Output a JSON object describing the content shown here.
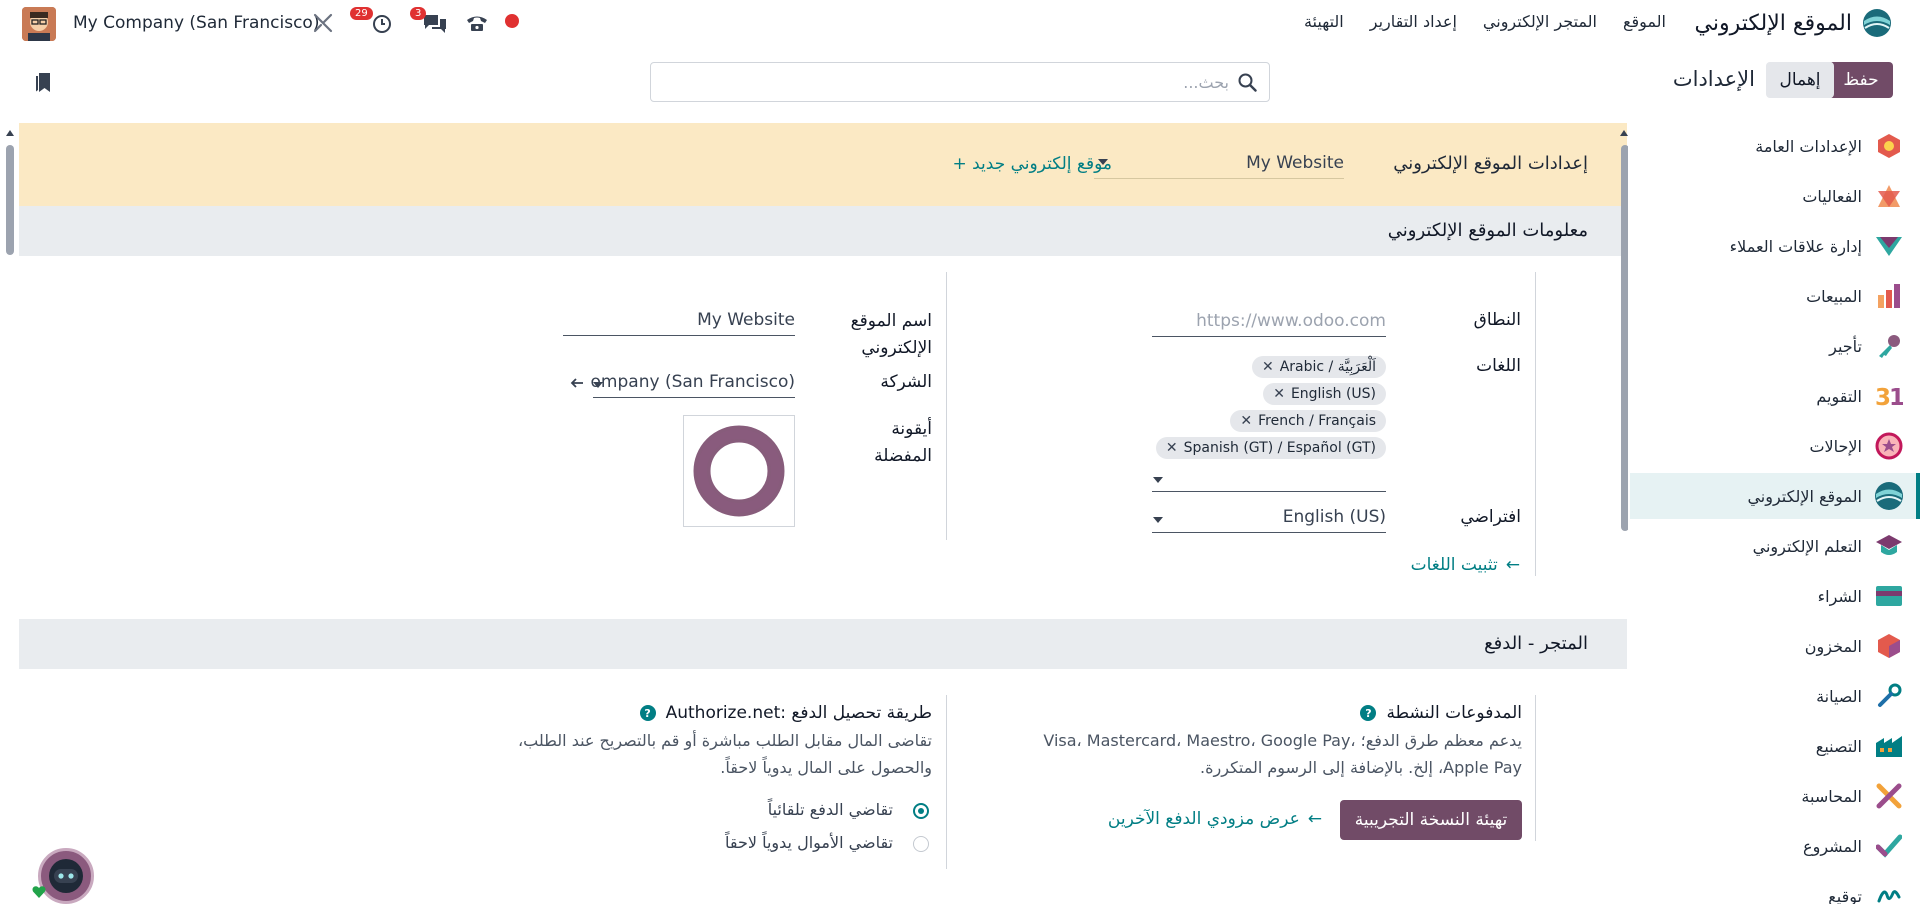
{
  "navbar": {
    "app_title": "الموقع الإلكتروني",
    "menu": [
      "الموقع",
      "المتجر الإلكتروني",
      "إعداد التقارير",
      "التهيئة"
    ],
    "company": "My Company (San Francisco)",
    "activity_count": "29",
    "messages_count": "3",
    "recording_color": "#e03131"
  },
  "control_panel": {
    "save_label": "حفظ",
    "discard_label": "إهمال",
    "title": "الإعدادات",
    "search_placeholder": "بحث..."
  },
  "sidebar": {
    "items": [
      {
        "label": "الإعدادات العامة",
        "icon": "general-settings-icon"
      },
      {
        "label": "الفعاليات",
        "icon": "events-icon"
      },
      {
        "label": "إدارة علاقات العملاء",
        "icon": "crm-icon"
      },
      {
        "label": "المبيعات",
        "icon": "sales-icon"
      },
      {
        "label": "تأجير",
        "icon": "rental-icon"
      },
      {
        "label": "التقويم",
        "icon": "calendar-icon"
      },
      {
        "label": "الإحالات",
        "icon": "referrals-icon"
      },
      {
        "label": "الموقع الإلكتروني",
        "icon": "website-icon",
        "active": true
      },
      {
        "label": "التعلم الإلكتروني",
        "icon": "elearning-icon"
      },
      {
        "label": "الشراء",
        "icon": "purchase-icon"
      },
      {
        "label": "المخزون",
        "icon": "inventory-icon"
      },
      {
        "label": "الصيانة",
        "icon": "maintenance-icon"
      },
      {
        "label": "التصنيع",
        "icon": "manufacturing-icon"
      },
      {
        "label": "المحاسبة",
        "icon": "accounting-icon"
      },
      {
        "label": "المشروع",
        "icon": "project-icon"
      },
      {
        "label": "توقيع",
        "icon": "sign-icon"
      }
    ]
  },
  "website_bar": {
    "label": "إعدادات الموقع الإلكتروني",
    "selected_website": "My Website",
    "new_website": "+ موقع إلكتروني جديد"
  },
  "website_info": {
    "section_title": "معلومات الموقع الإلكتروني",
    "domain_label": "النطاق",
    "domain_placeholder": "https://www.odoo.com",
    "languages_label": "اللغات",
    "languages": [
      "Arabic / اَلْعَرَبِيَّة",
      "English (US)",
      "French / Français",
      "Spanish (GT) / Español (GT)"
    ],
    "default_label": "افتراضي",
    "default_value": "English (US)",
    "install_languages": "تثبيت اللغات",
    "website_name_label": "اسم الموقع الإلكتروني",
    "website_name_value": "My Website",
    "company_label": "الشركة",
    "company_value": "ompany (San Francisco)",
    "favicon_label": "أيقونة المفضلة"
  },
  "shop_payment": {
    "section_title": "المتجر - الدفع",
    "active_payments_title": "المدفوعات النشطة",
    "active_payments_desc": "يدعم معظم طرق الدفع؛ Visa، Mastercard، Maestro، Google Pay، Apple Pay، إلخ. بالإضافة إلى الرسوم المتكررة.",
    "configure_demo_btn": "تهيئة النسخة التجريبية",
    "view_providers_link": "عرض مزودي الدفع الآخرين",
    "authorize_title": "Authorize.net: طريقة تحصيل الدفع",
    "authorize_desc": "تقاضى المال مقابل الطلب مباشرة أو قم بالتصريح عند الطلب، والحصول على المال يدوياً لاحقاً.",
    "option_auto": "تقاضي الدفع تلقائياً",
    "option_manual": "تقاضي الأموال يدوياً لاحقاً"
  }
}
